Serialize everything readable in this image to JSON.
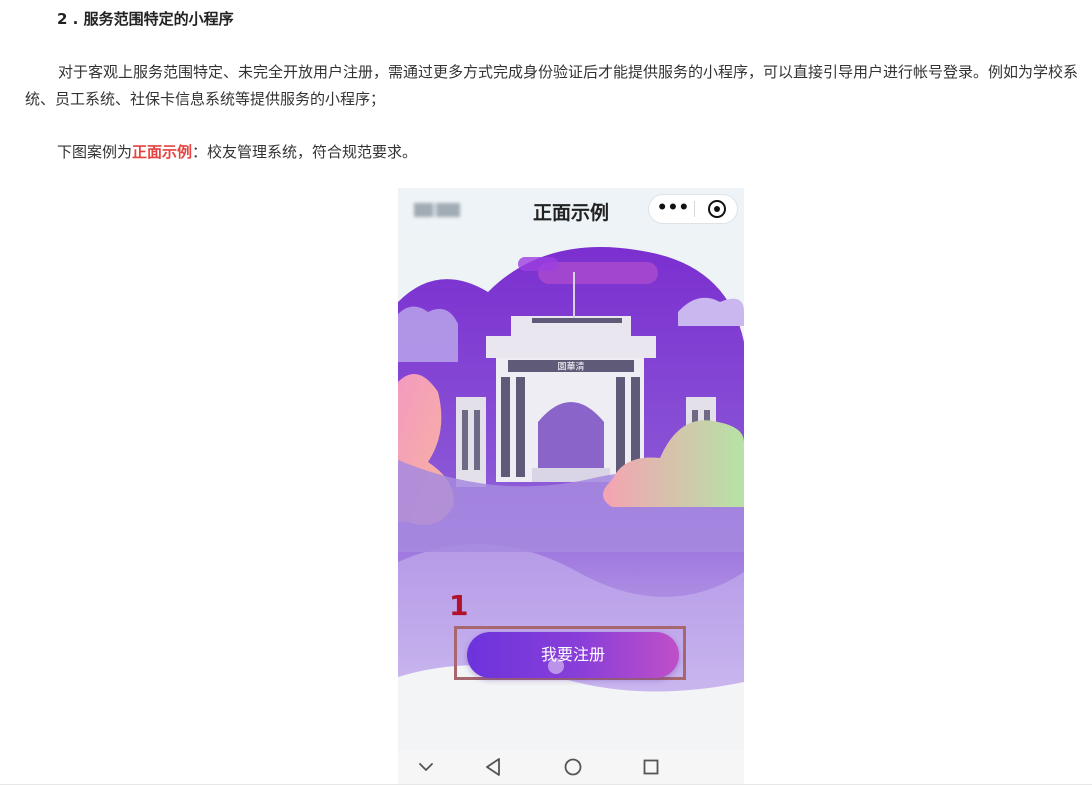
{
  "article": {
    "heading": "2 . 服务范围特定的小程序",
    "paragraph1": "对于客观上服务范围特定、未完全开放用户注册，需通过更多方式完成身份验证后才能提供服务的小程序，可以直接引导用户进行帐号登录。例如为学校系统、员工系统、社保卡信息系统等提供服务的小程序；",
    "paragraph2_prefix": "下图案例为",
    "paragraph2_emphasis": "正面示例",
    "paragraph2_suffix": "：校友管理系统，符合规范要求。"
  },
  "phone": {
    "nav_title": "正面示例",
    "capsule_more_symbol": "•••",
    "annotation_number": "1",
    "register_button_label": "我要注册",
    "gate_plaque_text": "園華清"
  },
  "icons": {
    "more": "more-dots-icon",
    "close_target": "target-icon",
    "down": "chevron-down-icon",
    "back": "triangle-back-icon",
    "home": "circle-home-icon",
    "recent": "square-recent-icon"
  },
  "colors": {
    "emphasis": "#e64340",
    "annotation": "#b0112b",
    "button_start": "#6c33dc",
    "button_end": "#c04fc8"
  }
}
